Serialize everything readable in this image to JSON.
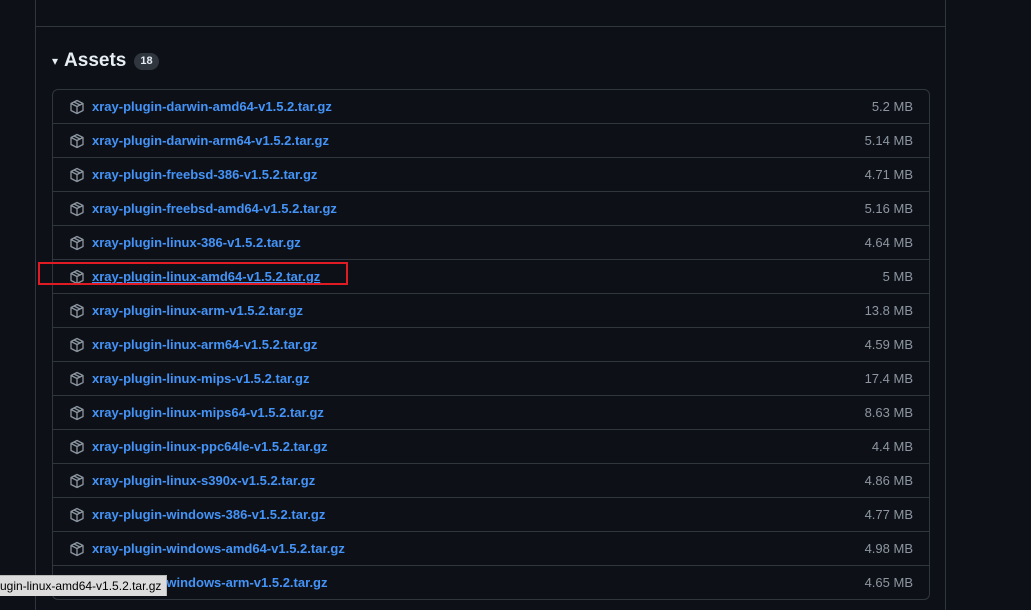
{
  "assets": {
    "caret": "▾",
    "title": "Assets",
    "count": "18",
    "items": [
      {
        "name": "xray-plugin-darwin-amd64-v1.5.2.tar.gz",
        "size": "5.2 MB"
      },
      {
        "name": "xray-plugin-darwin-arm64-v1.5.2.tar.gz",
        "size": "5.14 MB"
      },
      {
        "name": "xray-plugin-freebsd-386-v1.5.2.tar.gz",
        "size": "4.71 MB"
      },
      {
        "name": "xray-plugin-freebsd-amd64-v1.5.2.tar.gz",
        "size": "5.16 MB"
      },
      {
        "name": "xray-plugin-linux-386-v1.5.2.tar.gz",
        "size": "4.64 MB"
      },
      {
        "name": "xray-plugin-linux-amd64-v1.5.2.tar.gz",
        "size": "5 MB"
      },
      {
        "name": "xray-plugin-linux-arm-v1.5.2.tar.gz",
        "size": "13.8 MB"
      },
      {
        "name": "xray-plugin-linux-arm64-v1.5.2.tar.gz",
        "size": "4.59 MB"
      },
      {
        "name": "xray-plugin-linux-mips-v1.5.2.tar.gz",
        "size": "17.4 MB"
      },
      {
        "name": "xray-plugin-linux-mips64-v1.5.2.tar.gz",
        "size": "8.63 MB"
      },
      {
        "name": "xray-plugin-linux-ppc64le-v1.5.2.tar.gz",
        "size": "4.4 MB"
      },
      {
        "name": "xray-plugin-linux-s390x-v1.5.2.tar.gz",
        "size": "4.86 MB"
      },
      {
        "name": "xray-plugin-windows-386-v1.5.2.tar.gz",
        "size": "4.77 MB"
      },
      {
        "name": "xray-plugin-windows-amd64-v1.5.2.tar.gz",
        "size": "4.98 MB"
      },
      {
        "name": "xray-plugin-windows-arm-v1.5.2.tar.gz",
        "size": "4.65 MB"
      }
    ]
  },
  "status_bar": {
    "url": "ugin-linux-amd64-v1.5.2.tar.gz"
  },
  "colors": {
    "background": "#0d1117",
    "border": "#30363d",
    "link": "#4493f8",
    "muted": "#8d96a0",
    "highlight": "#e01b24"
  },
  "icons": {
    "package": "package-icon",
    "caret": "triangle-down-icon"
  }
}
